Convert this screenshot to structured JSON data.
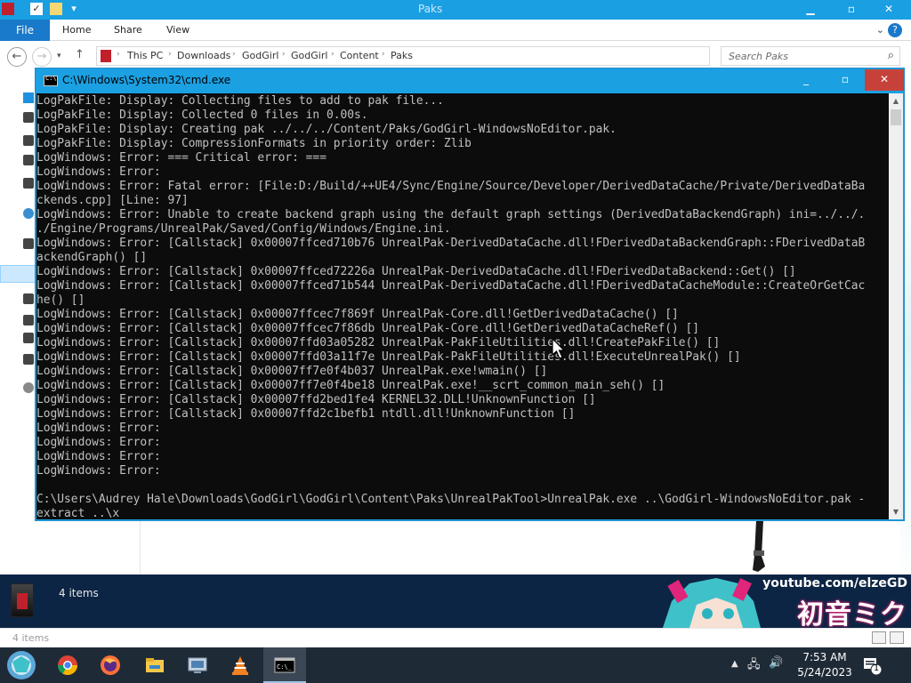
{
  "explorer": {
    "title": "Paks",
    "ribbon_tabs": [
      "File",
      "Home",
      "Share",
      "View"
    ],
    "address": [
      "This PC",
      "Downloads",
      "GodGirl",
      "GodGirl",
      "Content",
      "Paks"
    ],
    "search_placeholder": "Search Paks",
    "status_count": "4 items"
  },
  "media_bar": {
    "items": "4 items",
    "channel": "youtube.com/elzeGD",
    "logo_text": "初音ミク"
  },
  "cmd": {
    "title": "C:\\Windows\\System32\\cmd.exe",
    "lines": [
      "LogPakFile: Display: Collecting files to add to pak file...",
      "LogPakFile: Display: Collected 0 files in 0.00s.",
      "LogPakFile: Display: Creating pak ../../../Content/Paks/GodGirl-WindowsNoEditor.pak.",
      "LogPakFile: Display: CompressionFormats in priority order: Zlib",
      "LogWindows: Error: === Critical error: ===",
      "LogWindows: Error:",
      "LogWindows: Error: Fatal error: [File:D:/Build/++UE4/Sync/Engine/Source/Developer/DerivedDataCache/Private/DerivedDataBa",
      "ckends.cpp] [Line: 97]",
      "LogWindows: Error: Unable to create backend graph using the default graph settings (DerivedDataBackendGraph) ini=../../.",
      "./Engine/Programs/UnrealPak/Saved/Config/Windows/Engine.ini.",
      "LogWindows: Error: [Callstack] 0x00007ffced710b76 UnrealPak-DerivedDataCache.dll!FDerivedDataBackendGraph::FDerivedDataB",
      "ackendGraph() []",
      "LogWindows: Error: [Callstack] 0x00007ffced72226a UnrealPak-DerivedDataCache.dll!FDerivedDataBackend::Get() []",
      "LogWindows: Error: [Callstack] 0x00007ffced71b544 UnrealPak-DerivedDataCache.dll!FDerivedDataCacheModule::CreateOrGetCac",
      "he() []",
      "LogWindows: Error: [Callstack] 0x00007ffcec7f869f UnrealPak-Core.dll!GetDerivedDataCache() []",
      "LogWindows: Error: [Callstack] 0x00007ffcec7f86db UnrealPak-Core.dll!GetDerivedDataCacheRef() []",
      "LogWindows: Error: [Callstack] 0x00007ffd03a05282 UnrealPak-PakFileUtilities.dll!CreatePakFile() []",
      "LogWindows: Error: [Callstack] 0x00007ffd03a11f7e UnrealPak-PakFileUtilities.dll!ExecuteUnrealPak() []",
      "LogWindows: Error: [Callstack] 0x00007ff7e0f4b037 UnrealPak.exe!wmain() []",
      "LogWindows: Error: [Callstack] 0x00007ff7e0f4be18 UnrealPak.exe!__scrt_common_main_seh() []",
      "LogWindows: Error: [Callstack] 0x00007ffd2bed1fe4 KERNEL32.DLL!UnknownFunction []",
      "LogWindows: Error: [Callstack] 0x00007ffd2c1befb1 ntdll.dll!UnknownFunction []",
      "LogWindows: Error:",
      "LogWindows: Error:",
      "LogWindows: Error:",
      "LogWindows: Error:",
      "",
      "C:\\Users\\Audrey Hale\\Downloads\\GodGirl\\GodGirl\\Content\\Paks\\UnrealPakTool>UnrealPak.exe ..\\GodGirl-WindowsNoEditor.pak -",
      "extract ..\\x"
    ]
  },
  "taskbar": {
    "apps": [
      "start",
      "chrome",
      "firefox",
      "file-explorer",
      "control-panel",
      "vlc",
      "cmd"
    ],
    "active_app": "cmd",
    "clock_time": "7:53 AM",
    "clock_date": "5/24/2023",
    "notification_count": "1"
  },
  "colors": {
    "title_blue": "#1ba0e2",
    "console_bg": "#0c0c0c",
    "console_text": "#c0c0c0",
    "close_red": "#c7413b",
    "taskbar_bg": "#1f2a37"
  }
}
